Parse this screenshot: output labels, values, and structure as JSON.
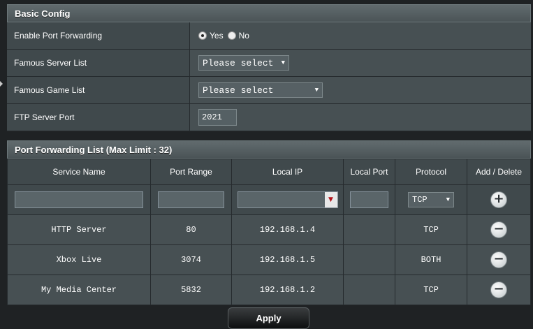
{
  "basic": {
    "header": "Basic Config",
    "rows": [
      {
        "label": "Enable Port Forwarding"
      },
      {
        "label": "Famous Server List",
        "select_value": "Please select"
      },
      {
        "label": "Famous Game List",
        "select_value": "Please select"
      },
      {
        "label": "FTP Server Port",
        "value": "2021"
      }
    ],
    "radio_yes": "Yes",
    "radio_no": "No",
    "radio_selected": "Yes"
  },
  "pf": {
    "header": "Port Forwarding List (Max Limit : 32)",
    "columns": [
      "Service Name",
      "Port Range",
      "Local IP",
      "Local Port",
      "Protocol",
      "Add / Delete"
    ],
    "new_protocol": "TCP",
    "rows": [
      {
        "service": "HTTP Server",
        "port": "80",
        "ip": "192.168.1.4",
        "local_port": "",
        "protocol": "TCP"
      },
      {
        "service": "Xbox Live",
        "port": "3074",
        "ip": "192.168.1.5",
        "local_port": "",
        "protocol": "BOTH"
      },
      {
        "service": "My Media Center",
        "port": "5832",
        "ip": "192.168.1.2",
        "local_port": "",
        "protocol": "TCP"
      }
    ]
  },
  "apply_label": "Apply",
  "icons": {
    "add": "plus-circle-icon",
    "delete": "minus-circle-icon"
  }
}
